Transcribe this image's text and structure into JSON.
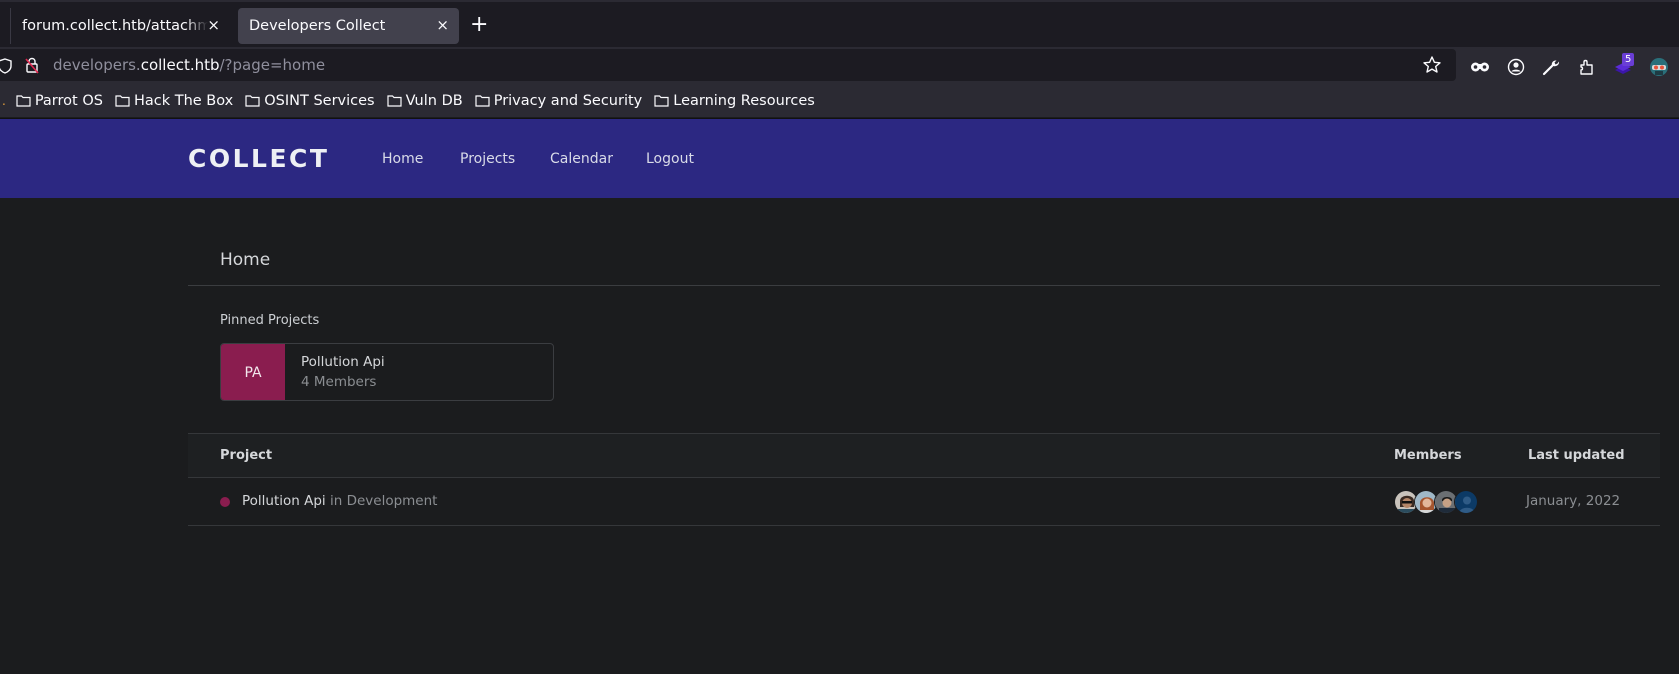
{
  "browser": {
    "tabs": [
      {
        "title": "forum.collect.htb/attachment",
        "active": false
      },
      {
        "title": "Developers Collect",
        "active": true
      }
    ],
    "new_tab_icon": "plus-icon",
    "close_icon": "×",
    "url": {
      "prefix": "developers.",
      "host": "collect.htb",
      "path": "/?page=home"
    },
    "toolbar_icons": [
      "star-icon",
      "mask-icon",
      "account-icon",
      "wrench-icon",
      "extensions-icon",
      "extension-layers-icon",
      "extension-avatar-icon"
    ],
    "extension_badge": "5",
    "bookmarks": [
      "Parrot OS",
      "Hack The Box",
      "OSINT Services",
      "Vuln DB",
      "Privacy and Security",
      "Learning Resources"
    ]
  },
  "site": {
    "brand": "COLLECT",
    "nav": [
      "Home",
      "Projects",
      "Calendar",
      "Logout"
    ],
    "accent": "#2c2882",
    "project_color": "#8a1d4f"
  },
  "page": {
    "title": "Home",
    "pinned_label": "Pinned Projects",
    "pinned": {
      "initials": "PA",
      "name": "Pollution Api",
      "members": "4 Members"
    },
    "table": {
      "headers": [
        "Project",
        "Members",
        "Last updated"
      ],
      "rows": [
        {
          "name": "Pollution Api",
          "stage": "in Development",
          "members": 4,
          "updated": "January, 2022"
        }
      ]
    }
  }
}
